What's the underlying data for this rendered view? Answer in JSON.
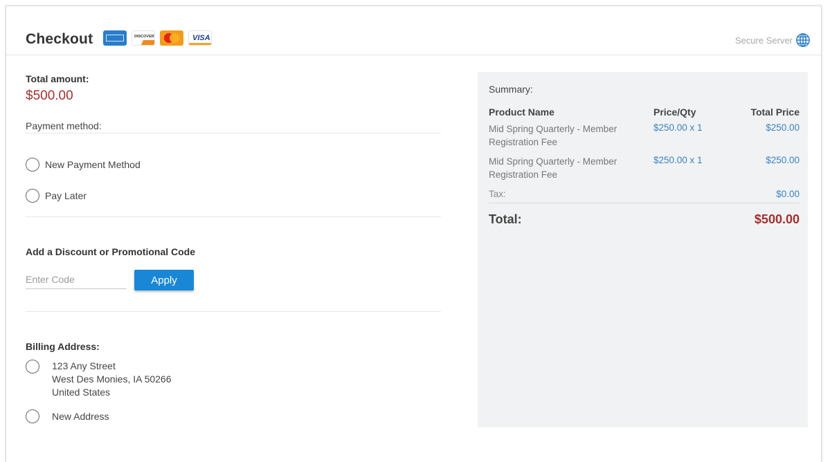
{
  "header": {
    "title": "Checkout",
    "card_icons": [
      "amex-icon",
      "discover-icon",
      "mastercard-icon",
      "visa-icon"
    ],
    "discover_text": "DISCOVER",
    "visa_text": "VISA",
    "secure_label": "Secure Server",
    "secure_icon": "globe-icon"
  },
  "payment": {
    "total_label": "Total amount:",
    "total_value": "$500.00",
    "method_label": "Payment method:",
    "options": [
      "New Payment Method",
      "Pay Later"
    ]
  },
  "discount": {
    "label": "Add a Discount or Promotional Code",
    "placeholder": "Enter Code",
    "value": "",
    "apply_label": "Apply"
  },
  "billing": {
    "label": "Billing Address:",
    "address_lines": [
      "123 Any Street",
      "West Des Monies, IA 50266",
      "United States"
    ],
    "new_address_label": "New Address"
  },
  "summary": {
    "title": "Summary:",
    "columns": [
      "Product Name",
      "Price/Qty",
      "Total Price"
    ],
    "rows": [
      {
        "name": "Mid Spring Quarterly - Member Registration Fee",
        "price_qty": "$250.00 x 1",
        "total": "$250.00"
      },
      {
        "name": "Mid Spring Quarterly - Member Registration Fee",
        "price_qty": "$250.00 x 1",
        "total": "$250.00"
      }
    ],
    "tax_label": "Tax:",
    "tax_value": "$0.00",
    "total_label": "Total:",
    "total_value": "$500.00"
  },
  "colors": {
    "accent_blue": "#1a87d6",
    "amount_red": "#a3302e",
    "link_blue": "#3b82c4",
    "summary_bg": "#f1f2f3"
  }
}
